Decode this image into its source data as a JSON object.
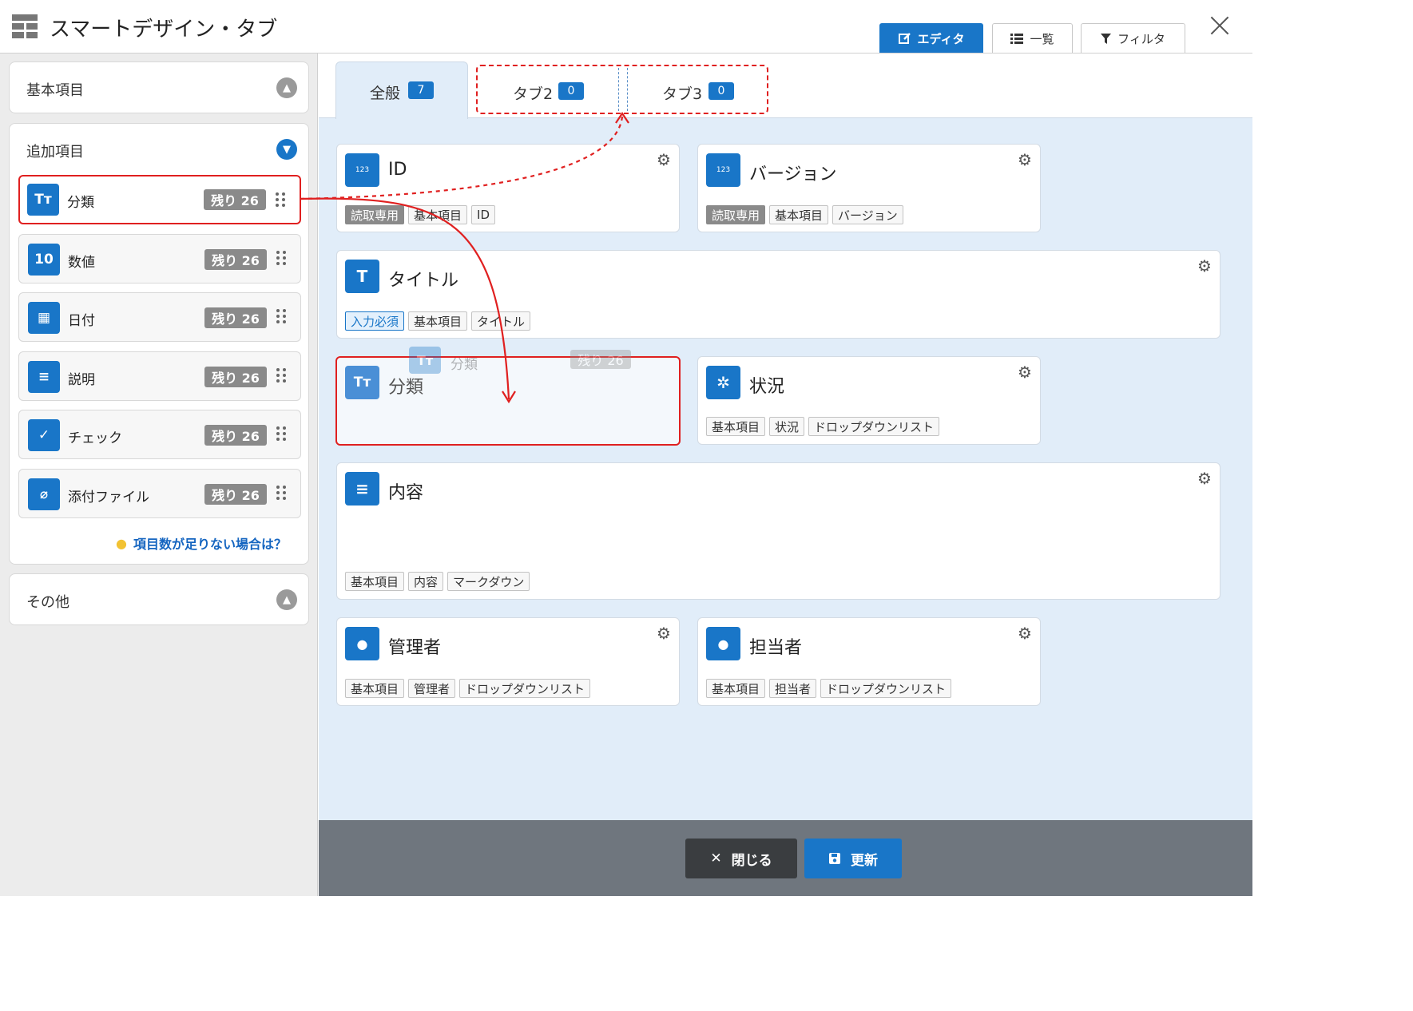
{
  "header": {
    "title": "スマートデザイン・タブ",
    "buttons": [
      {
        "label": "エディタ",
        "icon": "edit-icon"
      },
      {
        "label": "一覧",
        "icon": "list-icon"
      },
      {
        "label": "フィルタ",
        "icon": "filter-icon"
      }
    ]
  },
  "sidebar": {
    "basic": {
      "title": "基本項目"
    },
    "extra": {
      "title": "追加項目",
      "items": [
        {
          "label": "分類",
          "icon_text": "Tт",
          "remaining": "残り 26"
        },
        {
          "label": "数値",
          "icon_text": "10",
          "remaining": "残り 26"
        },
        {
          "label": "日付",
          "icon_text": "▦",
          "remaining": "残り 26"
        },
        {
          "label": "説明",
          "icon_text": "≡",
          "remaining": "残り 26"
        },
        {
          "label": "チェック",
          "icon_text": "✓",
          "remaining": "残り 26"
        },
        {
          "label": "添付ファイル",
          "icon_text": "⌀",
          "remaining": "残り 26"
        }
      ],
      "help_link": "項目数が足りない場合は？"
    },
    "other": {
      "title": "その他"
    }
  },
  "tabs": [
    {
      "label": "全般",
      "count": "7"
    },
    {
      "label": "タブ2",
      "count": "0"
    },
    {
      "label": "タブ3",
      "count": "0"
    }
  ],
  "cards": {
    "id": {
      "title": "ID",
      "icon_text": "123",
      "tags": [
        "読取専用",
        "基本項目",
        "ID"
      ]
    },
    "version": {
      "title": "バージョン",
      "icon_text": "123",
      "tags": [
        "読取専用",
        "基本項目",
        "バージョン"
      ]
    },
    "title": {
      "title": "タイトル",
      "icon_text": "T",
      "tags": [
        "入力必須",
        "基本項目",
        "タイトル"
      ]
    },
    "status": {
      "title": "状況",
      "icon_text": "✲",
      "tags": [
        "基本項目",
        "状況",
        "ドロップダウンリスト"
      ]
    },
    "content": {
      "title": "内容",
      "icon_text": "≡",
      "tags": [
        "基本項目",
        "内容",
        "マークダウン"
      ]
    },
    "manager": {
      "title": "管理者",
      "icon_text": "●",
      "tags": [
        "基本項目",
        "管理者",
        "ドロップダウンリスト"
      ]
    },
    "assignee": {
      "title": "担当者",
      "icon_text": "●",
      "tags": [
        "基本項目",
        "担当者",
        "ドロップダウンリスト"
      ]
    }
  },
  "drop_preview": {
    "title": "分類",
    "icon_text": "Tт",
    "ghost_label": "分類",
    "ghost_remaining": "残り 26"
  },
  "footer": {
    "close_label": "閉じる",
    "update_label": "更新"
  },
  "colors": {
    "accent": "#1976c8",
    "highlight": "#e02020",
    "main_bg": "#e1edf9"
  }
}
